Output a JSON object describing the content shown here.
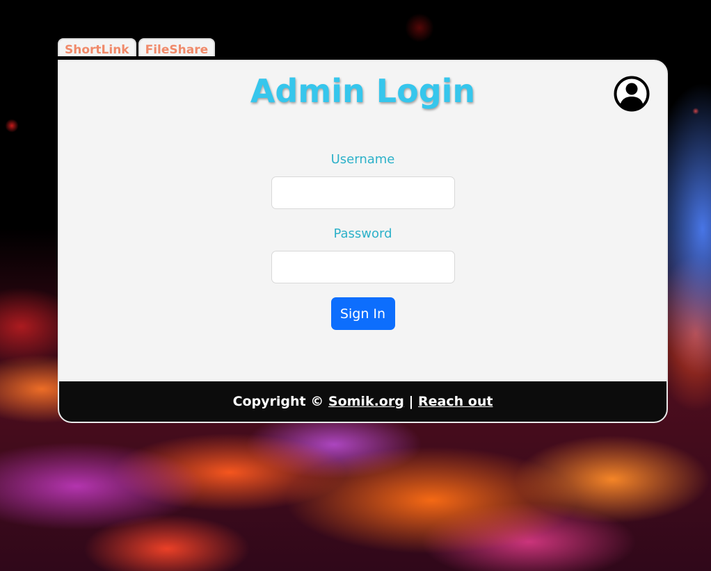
{
  "tabs": [
    {
      "label": "ShortLink"
    },
    {
      "label": "FileShare"
    }
  ],
  "card": {
    "title": "Admin Login",
    "account_icon": "account-circle-icon"
  },
  "form": {
    "username_label": "Username",
    "username_value": "",
    "password_label": "Password",
    "password_value": "",
    "submit_label": "Sign In"
  },
  "footer": {
    "copyright_text": "Copyright ©",
    "site_link": "Somik.org",
    "separator": "|",
    "contact_link": "Reach out"
  },
  "colors": {
    "title": "#36c6ec",
    "tab_text": "#f08a6a",
    "field_label": "#2db1c9",
    "button": "#0d6efd",
    "footer_bg": "#0c0c0c",
    "card_bg": "#f4f4f4"
  }
}
